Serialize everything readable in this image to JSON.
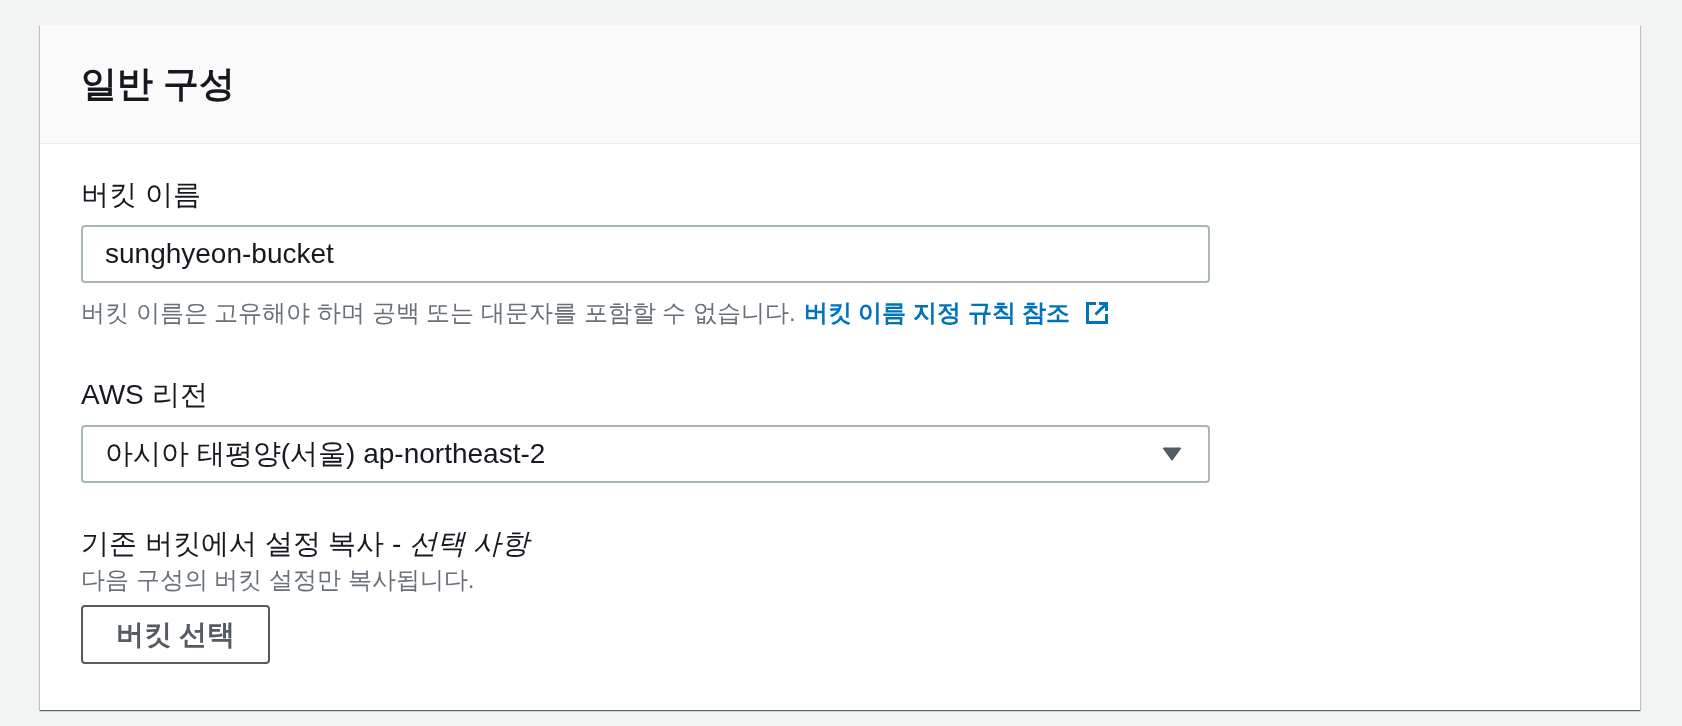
{
  "panel": {
    "title": "일반 구성"
  },
  "fields": [
    {
      "kind": "text",
      "label": "버킷 이름",
      "value": "sunghyeon-bucket",
      "help": "버킷 이름은 고유해야 하며 공백 또는 대문자를 포함할 수 없습니다.",
      "help_link": "버킷 이름 지정 규칙 참조"
    },
    {
      "kind": "select",
      "label": "AWS 리전",
      "value": "아시아 태평양(서울) ap-northeast-2"
    },
    {
      "kind": "button",
      "label": "기존 버킷에서 설정 복사 - *선택 사항*",
      "description": "다음 구성의 버킷 설정만 복사됩니다.",
      "button": "버킷 선택"
    }
  ]
}
